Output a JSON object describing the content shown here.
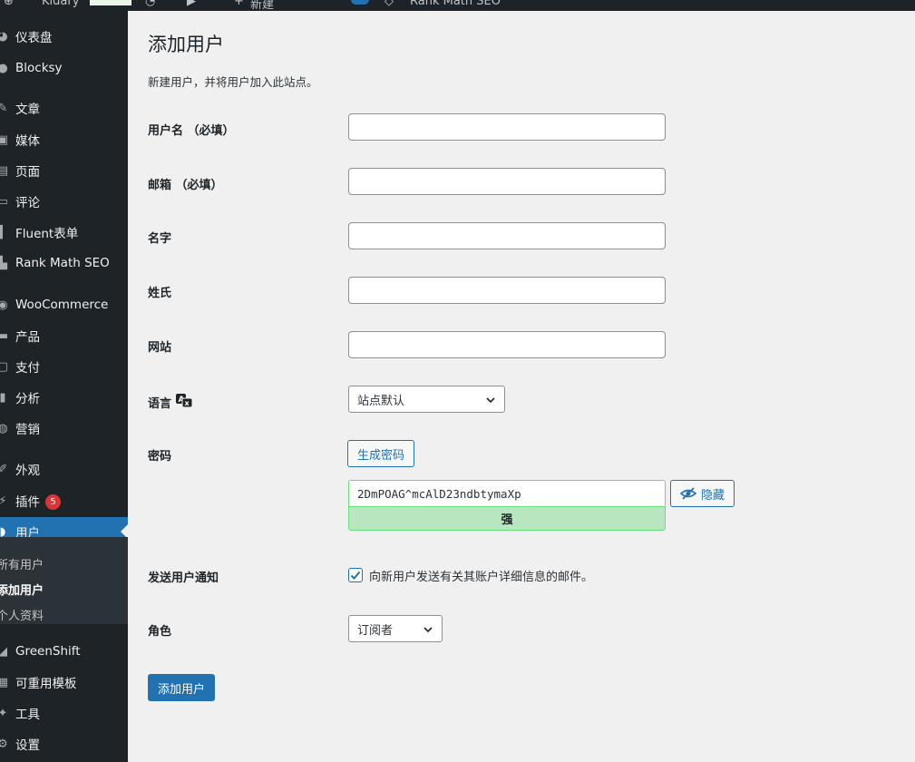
{
  "admin_bar": {
    "site_name": "Kidary",
    "new_label": "新建",
    "plugin_label": "Rank Math SEO"
  },
  "sidebar": {
    "items": [
      {
        "label": "仪表盘",
        "icon": "dashboard-icon"
      },
      {
        "label": "Blocksy",
        "icon": "blocksy-icon"
      },
      {
        "label": "文章",
        "icon": "pin-icon"
      },
      {
        "label": "媒体",
        "icon": "media-icon"
      },
      {
        "label": "页面",
        "icon": "page-icon"
      },
      {
        "label": "评论",
        "icon": "comment-icon"
      },
      {
        "label": "Fluent表单",
        "icon": "form-icon"
      },
      {
        "label": "Rank Math SEO",
        "icon": "chart-icon"
      },
      {
        "label": "WooCommerce",
        "icon": "woocommerce-icon"
      },
      {
        "label": "产品",
        "icon": "product-icon"
      },
      {
        "label": "支付",
        "icon": "payment-icon"
      },
      {
        "label": "分析",
        "icon": "analytics-icon"
      },
      {
        "label": "营销",
        "icon": "marketing-icon"
      },
      {
        "label": "外观",
        "icon": "brush-icon"
      },
      {
        "label": "插件",
        "icon": "plugin-icon",
        "badge": "5"
      },
      {
        "label": "用户",
        "icon": "user-icon"
      },
      {
        "label": "GreenShift",
        "icon": "greenshift-icon"
      },
      {
        "label": "可重用模板",
        "icon": "template-icon"
      },
      {
        "label": "工具",
        "icon": "wrench-icon"
      },
      {
        "label": "设置",
        "icon": "settings-icon"
      }
    ],
    "submenu": [
      "所有用户",
      "添加用户",
      "个人资料"
    ]
  },
  "page": {
    "title": "添加用户",
    "description": "新建用户，并将用户加入此站点。",
    "fields": {
      "username_label": "用户名 （必填）",
      "email_label": "邮箱 （必填）",
      "firstname_label": "名字",
      "lastname_label": "姓氏",
      "website_label": "网站",
      "language_label": "语言",
      "language_value": "站点默认",
      "password_label": "密码",
      "generate_password_button": "生成密码",
      "password_value": "2DmPOAG^mcAlD23ndbtymaXp",
      "password_strength": "强",
      "hide_button": "隐藏",
      "notify_label": "发送用户通知",
      "notify_checkbox_label": "向新用户发送有关其账户详细信息的邮件。",
      "notify_checked": true,
      "role_label": "角色",
      "role_value": "订阅者"
    },
    "submit_button": "添加用户"
  },
  "colors": {
    "sidebar_bg": "#1d2327",
    "accent": "#2271b1",
    "strength_bg": "#b8e6bf",
    "badge": "#d63638"
  }
}
